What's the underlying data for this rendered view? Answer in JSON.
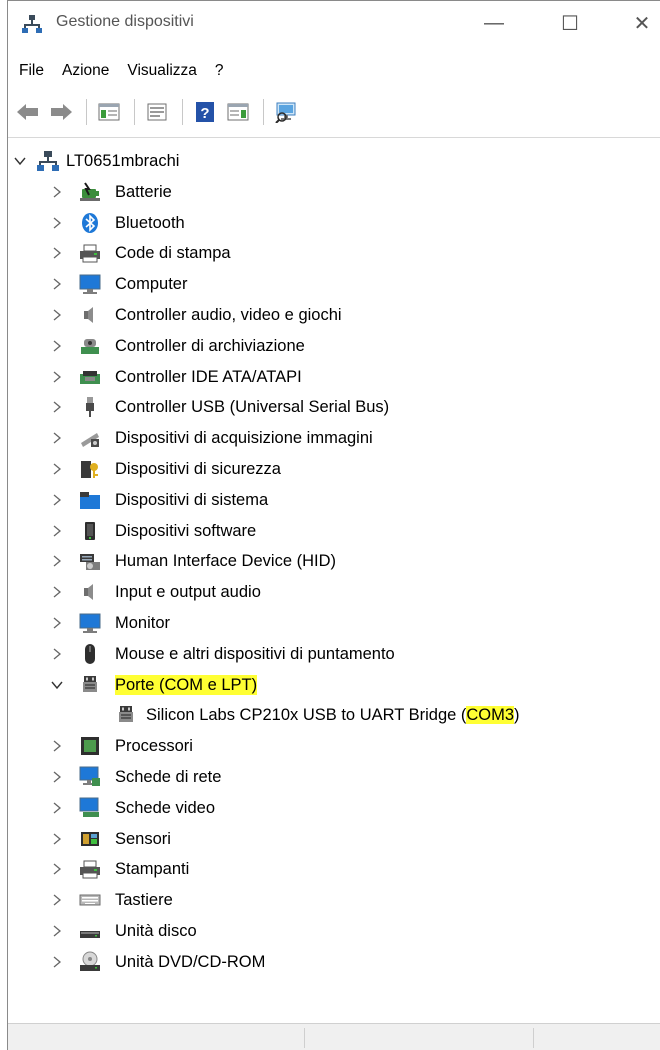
{
  "window": {
    "title": "Gestione dispositivi",
    "min_glyph": "—",
    "max_glyph": "☐",
    "close_glyph": "✕"
  },
  "menu": [
    "File",
    "Azione",
    "Visualizza",
    "?"
  ],
  "toolbar": {
    "buttons": [
      "back-arrow-icon",
      "forward-arrow-icon",
      "show-hide-console-tree-icon",
      "properties-icon",
      "help-icon",
      "action-pane-icon",
      "scan-hardware-icon"
    ]
  },
  "tree": {
    "root": "LT0651mbrachi",
    "categories": [
      {
        "label": "Batterie",
        "icon": "battery-icon"
      },
      {
        "label": "Bluetooth",
        "icon": "bluetooth-icon"
      },
      {
        "label": "Code di stampa",
        "icon": "print-queue-icon"
      },
      {
        "label": "Computer",
        "icon": "computer-icon"
      },
      {
        "label": "Controller audio, video e giochi",
        "icon": "speaker-icon"
      },
      {
        "label": "Controller di archiviazione",
        "icon": "storage-controller-icon"
      },
      {
        "label": "Controller IDE ATA/ATAPI",
        "icon": "ide-controller-icon"
      },
      {
        "label": "Controller USB (Universal Serial Bus)",
        "icon": "usb-icon"
      },
      {
        "label": "Dispositivi di acquisizione immagini",
        "icon": "camera-icon"
      },
      {
        "label": "Dispositivi di sicurezza",
        "icon": "security-device-icon"
      },
      {
        "label": "Dispositivi di sistema",
        "icon": "system-device-icon"
      },
      {
        "label": "Dispositivi software",
        "icon": "software-device-icon"
      },
      {
        "label": "Human Interface Device (HID)",
        "icon": "hid-icon"
      },
      {
        "label": "Input e output audio",
        "icon": "audio-io-icon"
      },
      {
        "label": "Monitor",
        "icon": "monitor-icon"
      },
      {
        "label": "Mouse e altri dispositivi di puntamento",
        "icon": "mouse-icon"
      },
      {
        "label": "Porte (COM e LPT)",
        "icon": "port-icon",
        "expanded": true,
        "highlighted": true,
        "children": [
          {
            "label_prefix": "Silicon Labs CP210x USB to UART Bridge (",
            "label_highlight": "COM3",
            "label_suffix": ")",
            "icon": "port-icon"
          }
        ]
      },
      {
        "label": "Processori",
        "icon": "processor-icon"
      },
      {
        "label": "Schede di rete",
        "icon": "network-adapter-icon"
      },
      {
        "label": "Schede video",
        "icon": "display-adapter-icon"
      },
      {
        "label": "Sensori",
        "icon": "sensor-icon"
      },
      {
        "label": "Stampanti",
        "icon": "printer-icon"
      },
      {
        "label": "Tastiere",
        "icon": "keyboard-icon"
      },
      {
        "label": "Unità disco",
        "icon": "disk-drive-icon"
      },
      {
        "label": "Unità DVD/CD-ROM",
        "icon": "dvd-drive-icon"
      }
    ]
  },
  "colors": {
    "highlight": "#ffff33",
    "accent_blue": "#1e78d7"
  }
}
